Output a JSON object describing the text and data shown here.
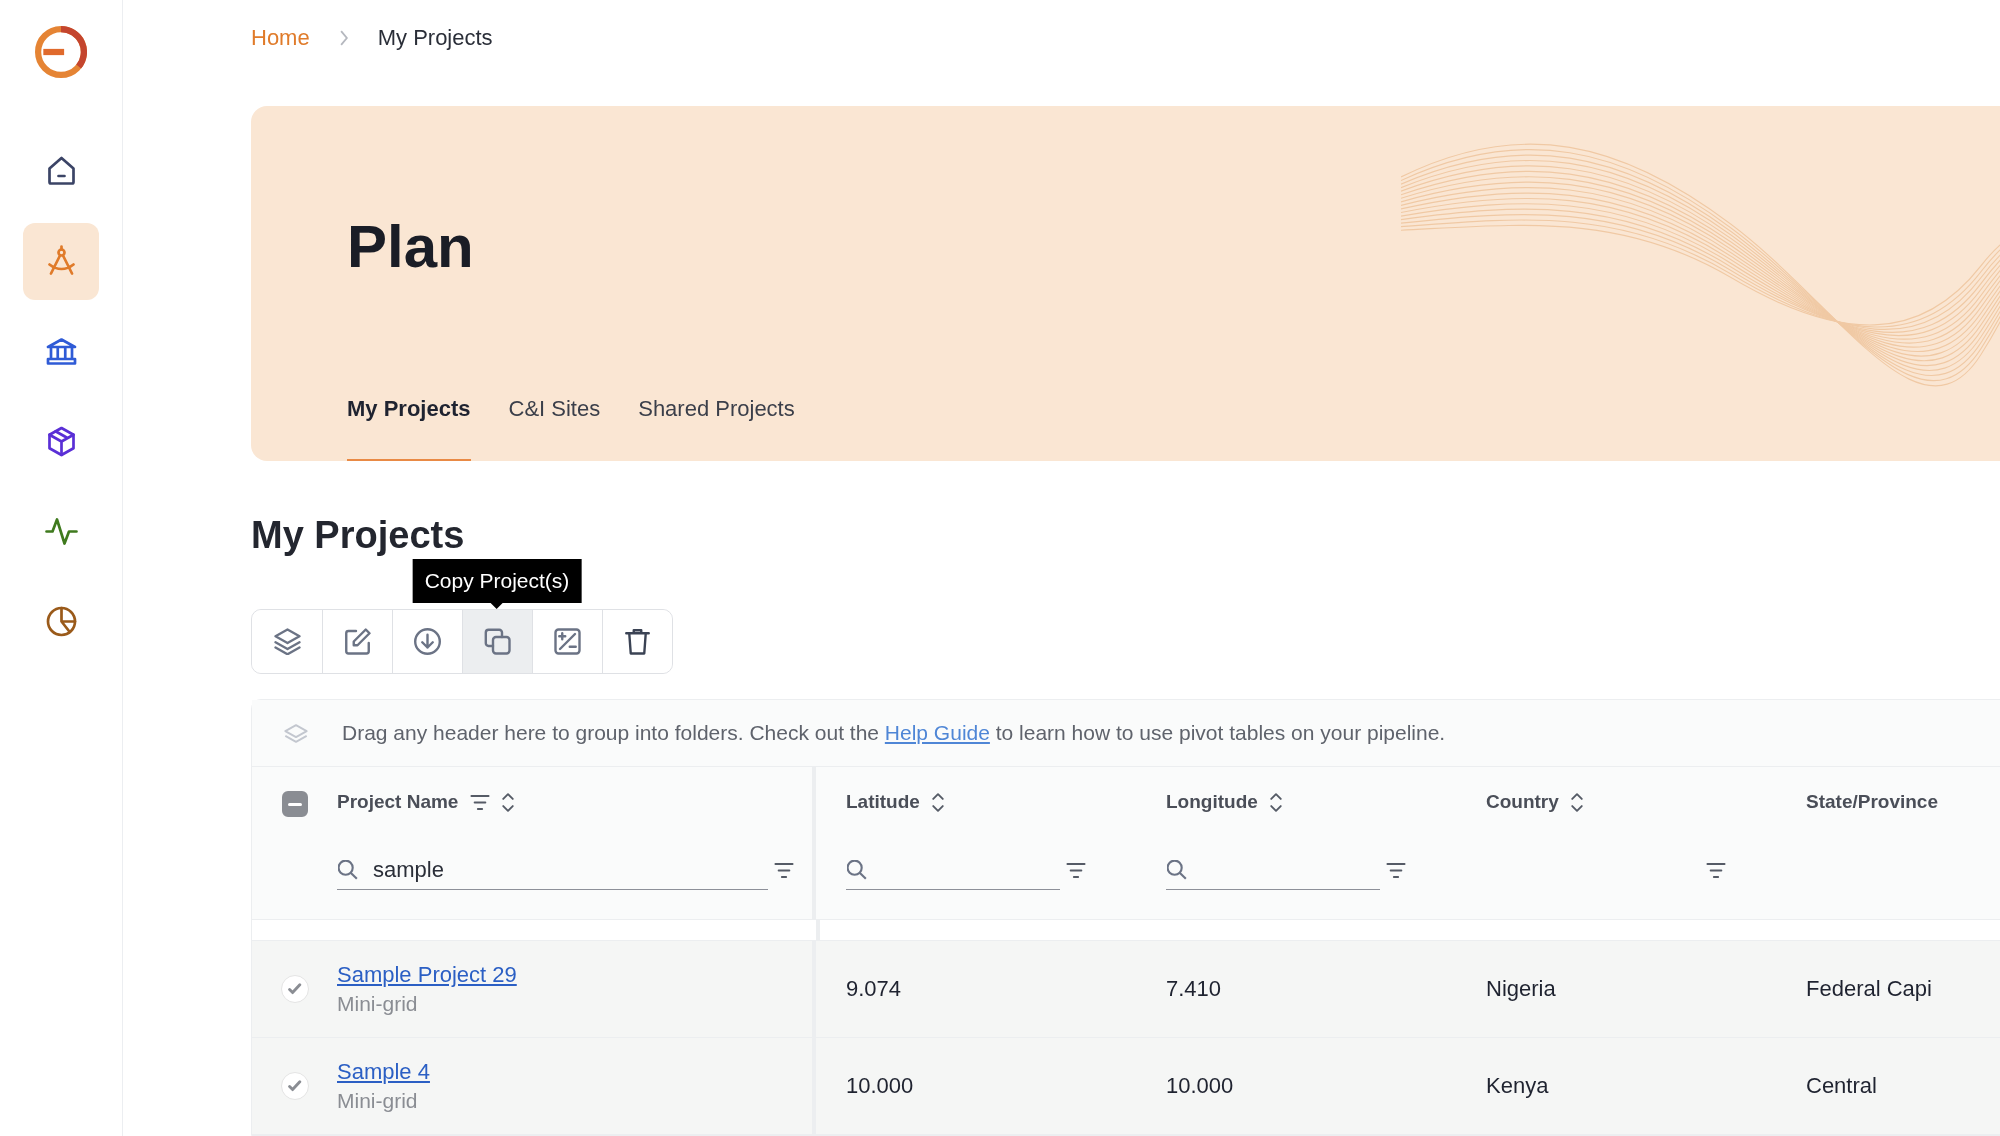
{
  "sidebar": {
    "items": [
      {
        "kind": "home",
        "selected": false,
        "color": "#3b4466"
      },
      {
        "kind": "compass",
        "selected": true,
        "color": "#e07b2a"
      },
      {
        "kind": "bank",
        "selected": false,
        "color": "#2f5bd6"
      },
      {
        "kind": "box",
        "selected": false,
        "color": "#5a2fd6"
      },
      {
        "kind": "pulse",
        "selected": false,
        "color": "#3f7a1e"
      },
      {
        "kind": "pie",
        "selected": false,
        "color": "#9a5a1a"
      }
    ]
  },
  "breadcrumb": [
    {
      "label": "Home",
      "current": false
    },
    {
      "label": "My Projects",
      "current": true
    }
  ],
  "banner": {
    "title": "Plan",
    "tabs": [
      {
        "label": "My Projects",
        "selected": true
      },
      {
        "label": "C&I Sites",
        "selected": false
      },
      {
        "label": "Shared Projects",
        "selected": false
      }
    ]
  },
  "section_title": "My Projects",
  "toolbar": {
    "buttons": [
      {
        "kind": "layers",
        "hovered": false
      },
      {
        "kind": "edit",
        "hovered": false
      },
      {
        "kind": "download",
        "hovered": false
      },
      {
        "kind": "copy",
        "hovered": true
      },
      {
        "kind": "percent",
        "hovered": false
      },
      {
        "kind": "trash",
        "hovered": false
      }
    ],
    "tooltip": "Copy Project(s)"
  },
  "group_panel": {
    "before": "Drag any header here to group into folders. Check out the ",
    "link": "Help Guide",
    "after": " to learn how to use pivot tables on your pipeline."
  },
  "table": {
    "select_all": {
      "partial": true
    },
    "columns": [
      {
        "label": "Project Name",
        "header_filter": true,
        "sortable": true,
        "has_search": true,
        "search_value": "sample",
        "filter_button": true
      },
      {
        "label": "Latitude",
        "header_filter": false,
        "sortable": true,
        "has_search": true,
        "filter_button": true
      },
      {
        "label": "Longitude",
        "header_filter": false,
        "sortable": true,
        "has_search": true,
        "filter_button": true
      },
      {
        "label": "Country",
        "header_filter": false,
        "sortable": true,
        "has_search": false,
        "filter_button": true
      },
      {
        "label": "State/Province",
        "header_filter": false,
        "sortable": false,
        "has_search": false,
        "filter_button": false
      }
    ],
    "rows": [
      {
        "checked": true,
        "cells": [
          {
            "name": "Sample Project 29",
            "type": "Mini-grid"
          },
          "9.074",
          "7.410",
          "Nigeria",
          "Federal Capi"
        ]
      },
      {
        "checked": true,
        "cells": [
          {
            "name": "Sample 4",
            "type": "Mini-grid"
          },
          "10.000",
          "10.000",
          "Kenya",
          "Central"
        ]
      }
    ]
  }
}
